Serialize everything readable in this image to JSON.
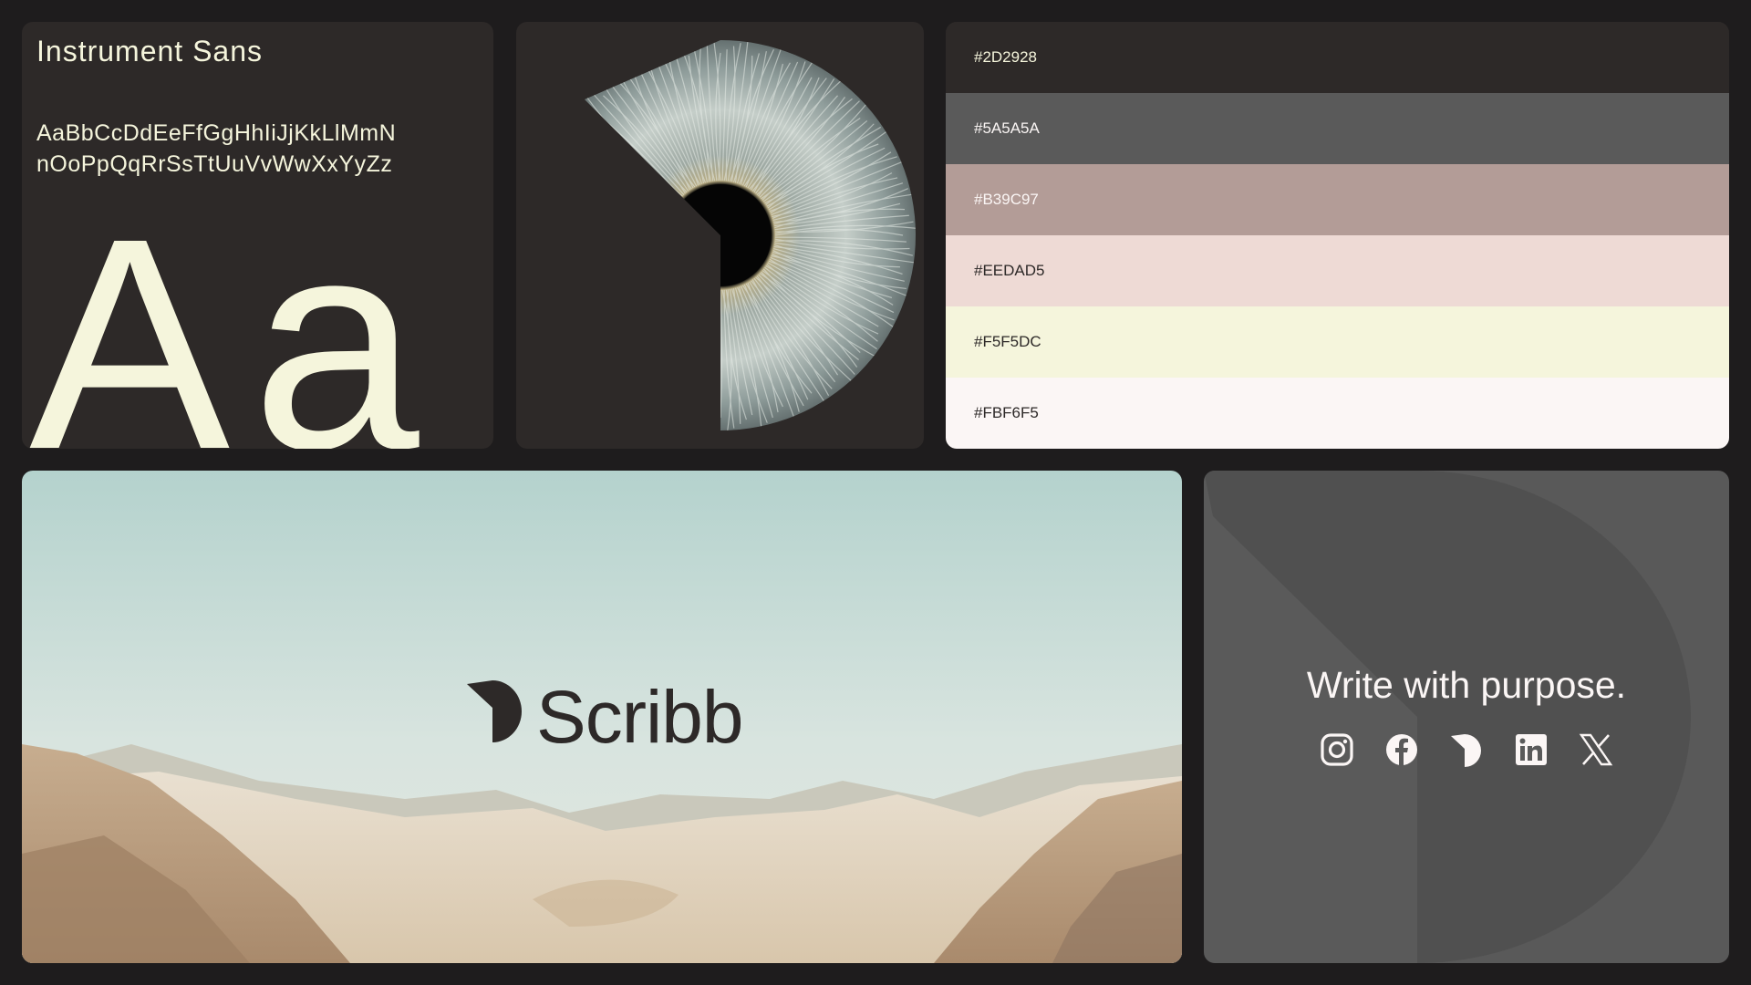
{
  "typography": {
    "font_name": "Instrument Sans",
    "alphabet_line1": "AaBbCcDdEeFfGgHhIiJjKkLlMmN",
    "alphabet_line2": "nOoPpQqRrSsTtUuVvWwXxYyZz",
    "sample": "Aa"
  },
  "palette": [
    {
      "hex": "#2D2928",
      "color": "#2d2928",
      "text_color": "#f5f5dc"
    },
    {
      "hex": "#5A5A5A",
      "color": "#5a5a5a",
      "text_color": "#fbf6f5"
    },
    {
      "hex": "#B39C97",
      "color": "#b39c97",
      "text_color": "#fbf6f5"
    },
    {
      "hex": "#EEDAD5",
      "color": "#eedad5",
      "text_color": "#2d2928"
    },
    {
      "hex": "#F5F5DC",
      "color": "#f5f5dc",
      "text_color": "#2d2928"
    },
    {
      "hex": "#FBF6F5",
      "color": "#fbf6f5",
      "text_color": "#2d2928"
    }
  ],
  "brand": {
    "name": "Scribb",
    "tagline": "Write with purpose."
  },
  "social_icons": [
    "instagram-icon",
    "facebook-icon",
    "scribb-icon",
    "linkedin-icon",
    "x-icon"
  ]
}
